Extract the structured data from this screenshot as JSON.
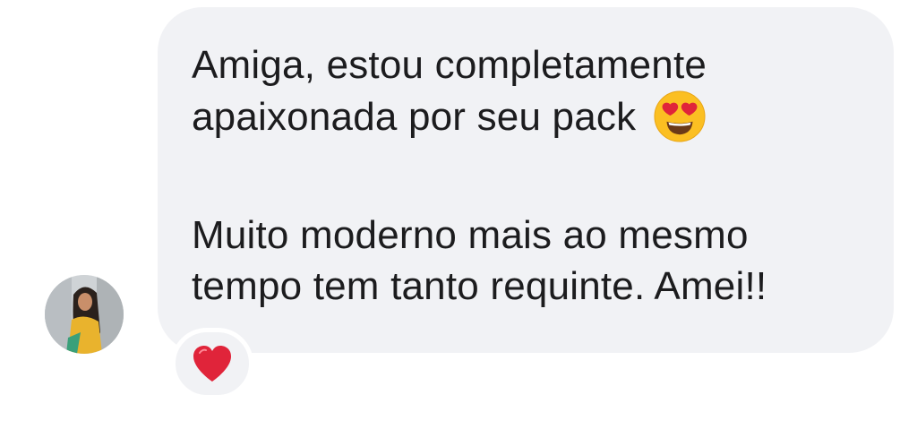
{
  "message": {
    "lines": [
      "Amiga, estou completamente",
      "apaixonada por seu pack",
      "Muito moderno mais ao mesmo",
      "tempo tem tanto requinte. Amei!!"
    ],
    "inline_emoji": "heart-eyes-face-icon"
  },
  "reaction": {
    "icon": "red-heart-icon"
  },
  "colors": {
    "bubble_bg": "#f1f2f5",
    "text": "#1c1c1e",
    "heart": "#e0243a",
    "emoji_face": "#fbbf22"
  }
}
